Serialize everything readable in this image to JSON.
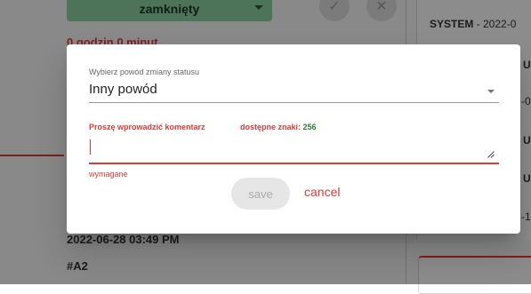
{
  "background": {
    "status_select_value": "zamknięty",
    "duration": "0 godzin 0 minut",
    "approve_icon": "check-icon",
    "reject_icon": "close-icon",
    "log_author": "SYSTEM",
    "log_date_partial": " - 2022-0",
    "side_marks": [
      "U",
      "-0",
      "U",
      "U",
      "-1"
    ],
    "entry_date": "2022-06-28 03:49 PM",
    "entry_id": "#A2"
  },
  "dialog": {
    "reason_label": "Wybierz powód zmiany statusu",
    "reason_value": "Inny powód",
    "comment_prompt": "Proszę wprowadzić komentarz",
    "chars_label": "dostępne znaki:",
    "chars_count": "256",
    "comment_value": "",
    "required_text": "wymagane",
    "save_label": "save",
    "cancel_label": "cancel"
  },
  "colors": {
    "accent_red": "#e53935",
    "status_green": "#8cd3a0",
    "count_green": "#2e7d32"
  }
}
